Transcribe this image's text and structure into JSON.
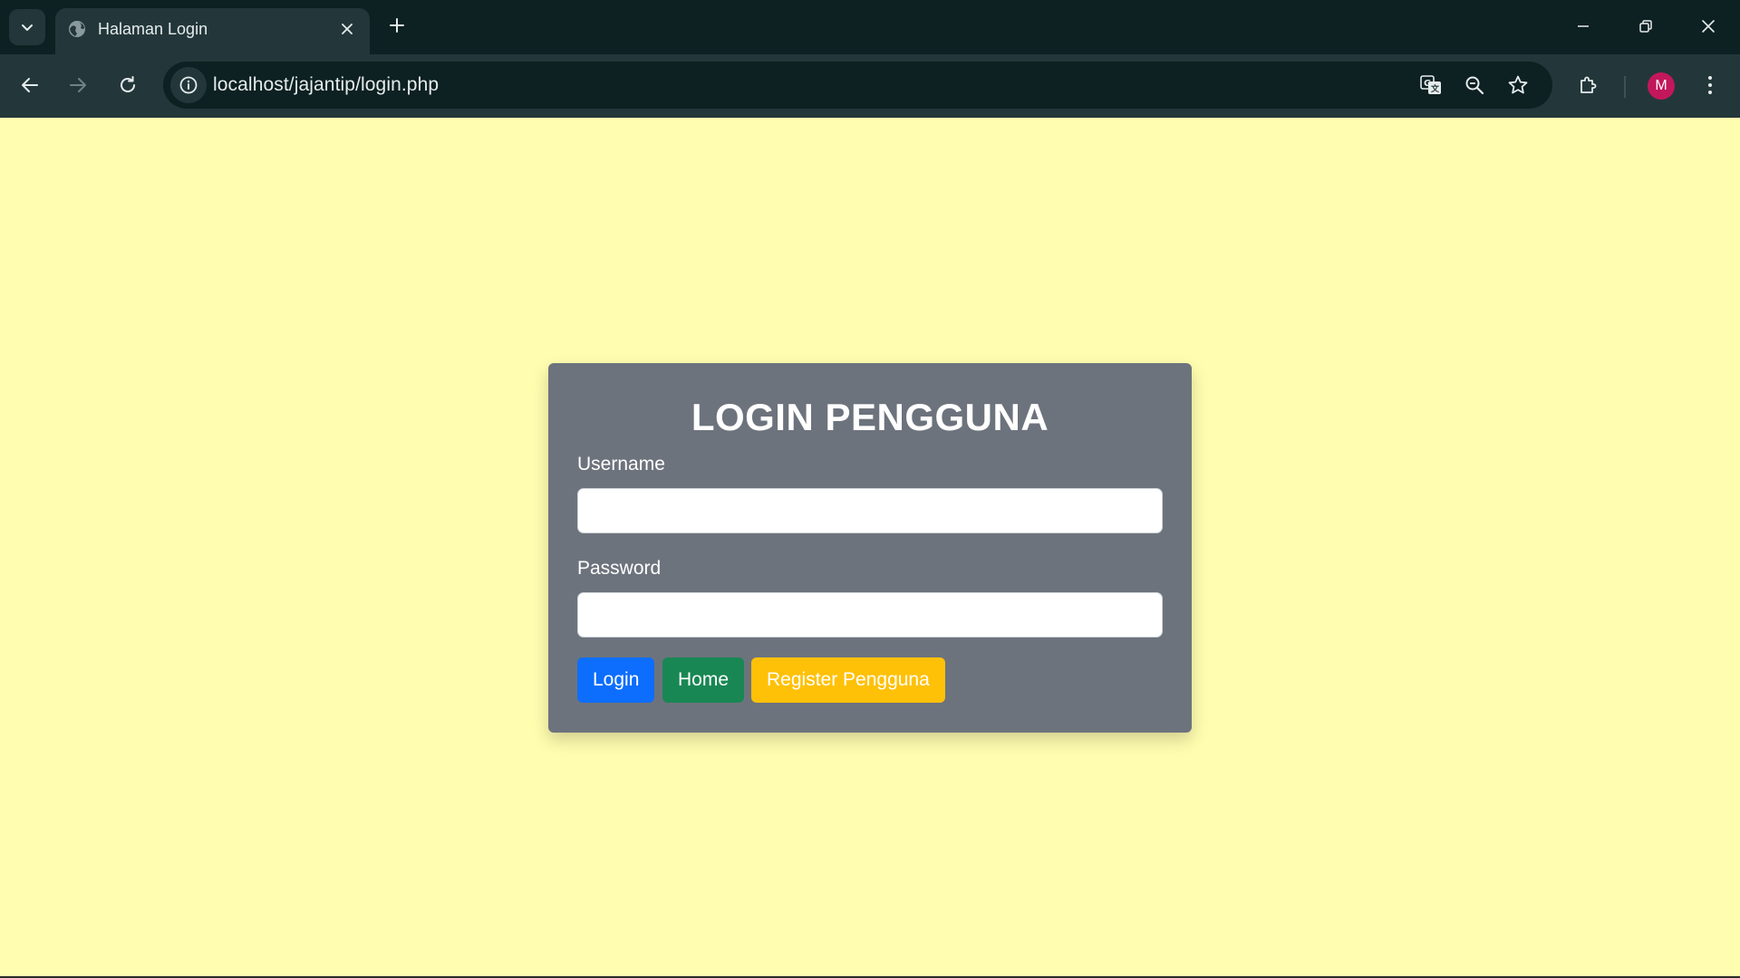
{
  "browser": {
    "tab_title": "Halaman Login",
    "url": "localhost/jajantip/login.php",
    "profile_initial": "M",
    "profile_color": "#c2185b"
  },
  "page": {
    "background_color": "#fffdaf",
    "card_color": "#6d737d",
    "title": "LOGIN PENGGUNA",
    "username_label": "Username",
    "username_value": "",
    "password_label": "Password",
    "password_value": "",
    "buttons": {
      "login": "Login",
      "home": "Home",
      "register": "Register Pengguna"
    },
    "button_colors": {
      "login": "#0d6efd",
      "home": "#198754",
      "register": "#ffc107"
    }
  }
}
